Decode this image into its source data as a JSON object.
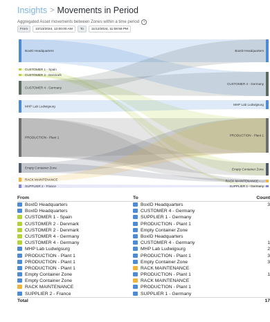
{
  "breadcrumb": {
    "parent": "Insights",
    "separator": ">",
    "current": "Movements in Period"
  },
  "subtitle": "Aggregated Asset movements between Zones within a time period",
  "help_icon": "help-circle-icon",
  "range": {
    "from_label": "From",
    "from_value": "10/13/2024, 12:00:00 AM",
    "to_label": "To",
    "to_value": "11/12/2024, 11:59:59 PM"
  },
  "colors": {
    "blue": "#4d8bd6",
    "green": "#b4d33a",
    "dark_green": "#5b6b62",
    "grey": "#6e6e6e",
    "dark_blue": "#505a6a",
    "orange": "#efb53a",
    "violet": "#8186d6"
  },
  "sankey": {
    "sources": [
      {
        "label": "BoxID Headquarters",
        "color": "#4d8bd6"
      },
      {
        "label": "CUSTOMER 1 - Spain",
        "color": "#b4d33a"
      },
      {
        "label": "CUSTOMER 2 - Denmark",
        "color": "#b4d33a"
      },
      {
        "label": "CUSTOMER 4 - Germany",
        "color": "#5b6b62"
      },
      {
        "label": "MHP Lab Ludwigsurg",
        "color": "#4d8bd6"
      },
      {
        "label": "PRODUCTION - Plant 1",
        "color": "#6e6e6e"
      },
      {
        "label": "Empty Container Zone",
        "color": "#505a6a"
      },
      {
        "label": "RACK MAINTENANCE",
        "color": "#efb53a"
      },
      {
        "label": "SUPPLIER 2 - France",
        "color": "#8186d6"
      }
    ],
    "targets": [
      {
        "label": "BoxID Headquarters",
        "color": "#4d8bd6"
      },
      {
        "label": "CUSTOMER 4 - Germany",
        "color": "#5b6b62"
      },
      {
        "label": "MHP Lab Ludwigsurg",
        "color": "#4d8bd6"
      },
      {
        "label": "PRODUCTION - Plant 1",
        "color": "#6e6e6e"
      },
      {
        "label": "Empty Container Zone",
        "color": "#505a6a"
      },
      {
        "label": "RACK MAINTENANCE - ...",
        "color": "#efb53a"
      },
      {
        "label": "SUPPLIER 1 - Germany",
        "color": "#8186d6"
      }
    ]
  },
  "table": {
    "headers": {
      "from": "From",
      "to": "To",
      "count": "Count"
    },
    "rows": [
      {
        "from": "BoxID Headquarters",
        "from_icon": "zone-blue-icon",
        "to": "BoxID Headquarters",
        "to_icon": "zone-blue-icon",
        "count": "3"
      },
      {
        "from": "BoxID Headquarters",
        "from_icon": "zone-blue-icon",
        "to": "CUSTOMER 4 - Germany",
        "to_icon": "zone-blue-icon",
        "count": ""
      },
      {
        "from": "CUSTOMER 1 - Spain",
        "from_icon": "zone-green-icon",
        "to": "SUPPLIER 1 - Germany",
        "to_icon": "zone-blue-icon",
        "count": ""
      },
      {
        "from": "CUSTOMER 2 - Denmark",
        "from_icon": "zone-green-icon",
        "to": "PRODUCTION - Plant 1",
        "to_icon": "zone-blue-icon",
        "count": ""
      },
      {
        "from": "CUSTOMER 2 - Denmark",
        "from_icon": "zone-green-icon",
        "to": "Empty Container Zone",
        "to_icon": "zone-blue-icon",
        "count": ""
      },
      {
        "from": "CUSTOMER 4 - Germany",
        "from_icon": "zone-green-icon",
        "to": "BoxID Headquarters",
        "to_icon": "zone-blue-icon",
        "count": ""
      },
      {
        "from": "CUSTOMER 4 - Germany",
        "from_icon": "zone-green-icon",
        "to": "CUSTOMER 4 - Germany",
        "to_icon": "zone-blue-icon",
        "count": "1"
      },
      {
        "from": "MHP Lab Ludwigsurg",
        "from_icon": "zone-blue-icon",
        "to": "MHP Lab Ludwigsurg",
        "to_icon": "zone-blue-icon",
        "count": "2"
      },
      {
        "from": "PRODUCTION - Plant 1",
        "from_icon": "zone-blue-icon",
        "to": "PRODUCTION - Plant 1",
        "to_icon": "zone-blue-icon",
        "count": "3"
      },
      {
        "from": "PRODUCTION - Plant 1",
        "from_icon": "zone-blue-icon",
        "to": "Empty Container Zone",
        "to_icon": "zone-blue-icon",
        "count": "3"
      },
      {
        "from": "PRODUCTION - Plant 1",
        "from_icon": "zone-blue-icon",
        "to": "RACK MAINTENANCE",
        "to_icon": "zone-orange-icon",
        "count": ""
      },
      {
        "from": "Empty Container Zone",
        "from_icon": "zone-blue-icon",
        "to": "PRODUCTION - Plant 1",
        "to_icon": "zone-blue-icon",
        "count": "1"
      },
      {
        "from": "Empty Container Zone",
        "from_icon": "zone-blue-icon",
        "to": "RACK MAINTENANCE",
        "to_icon": "zone-orange-icon",
        "count": ""
      },
      {
        "from": "RACK MAINTENANCE",
        "from_icon": "zone-orange-icon",
        "to": "PRODUCTION - Plant 1",
        "to_icon": "zone-blue-icon",
        "count": ""
      },
      {
        "from": "SUPPLIER 2 - France",
        "from_icon": "zone-blue-icon",
        "to": "SUPPLIER 1 - Germany",
        "to_icon": "zone-blue-icon",
        "count": ""
      }
    ],
    "total_label": "Total",
    "total_value": "17"
  }
}
